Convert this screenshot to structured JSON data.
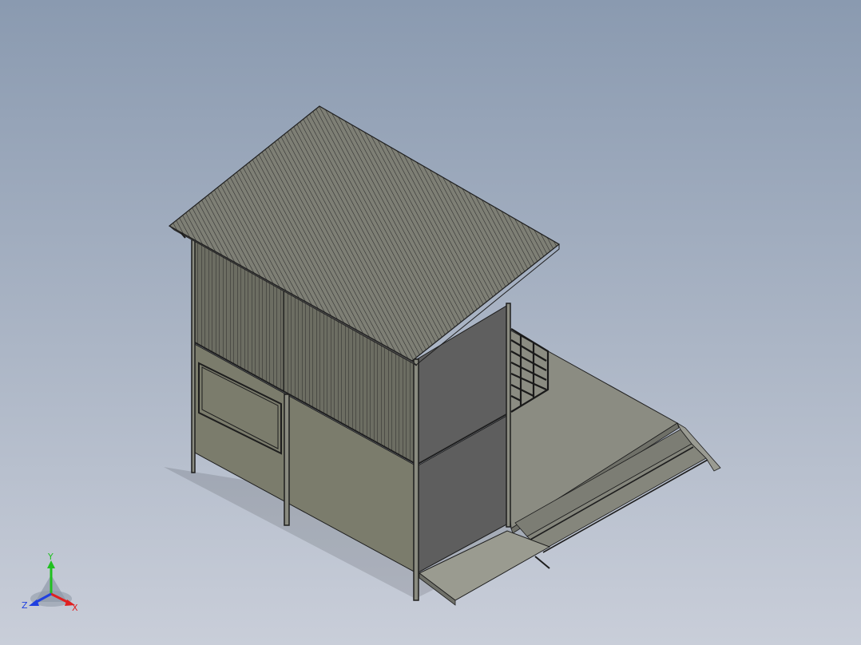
{
  "colors": {
    "background_top": "#8a9ab0",
    "background_bottom": "#c9ced9",
    "roof": "#7e7f75",
    "wall_front": "#7b7c6c",
    "wall_side": "#5f5f5f",
    "deck": "#8b8c82",
    "edge": "#1e1e1e",
    "axis_x": "#e02020",
    "axis_y": "#20c020",
    "axis_z": "#2040e0"
  },
  "triad": {
    "x_label": "X",
    "y_label": "Y",
    "z_label": "Z"
  }
}
